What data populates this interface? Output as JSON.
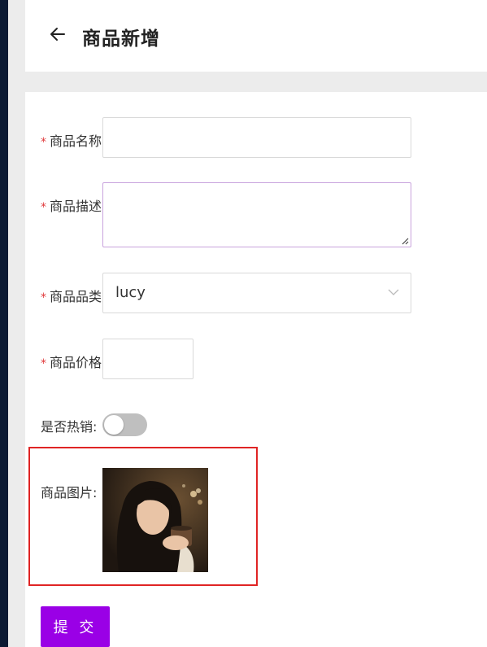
{
  "header": {
    "back_icon": "arrow-left-icon",
    "title": "商品新增"
  },
  "form": {
    "required_mark": "*",
    "name_label": "商品名称",
    "name_value": "",
    "description_label": "商品描述",
    "description_value": "",
    "category_label": "商品品类",
    "category_value": "lucy",
    "price_label": "商品价格",
    "price_value": "",
    "hot_label": "是否热销:",
    "hot_on": false,
    "image_label": "商品图片:",
    "submit_label": "提 交"
  },
  "colors": {
    "accent": "#9a00e6",
    "required": "#e0393b",
    "highlight": "#e02424",
    "sidebar": "#0c1a33"
  }
}
